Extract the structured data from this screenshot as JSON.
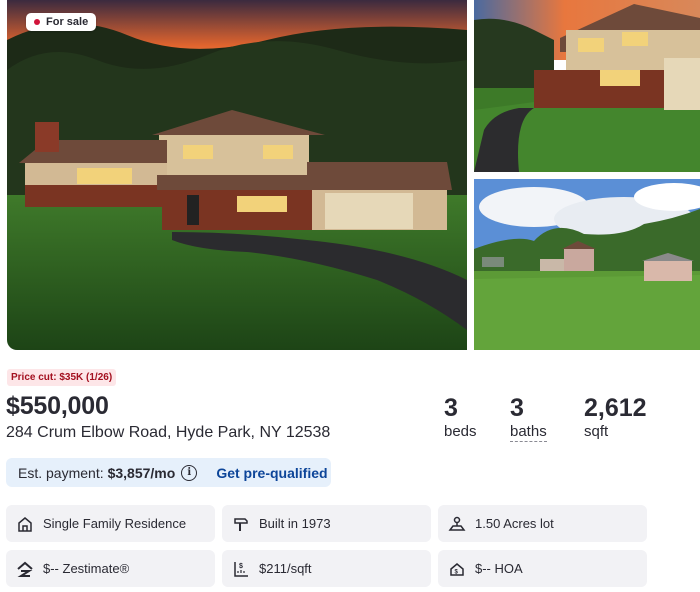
{
  "listing": {
    "status_badge": "For sale",
    "price_cut": "Price cut: $35K (1/26)",
    "price": "$550,000",
    "address": "284 Crum Elbow Road, Hyde Park, NY 12538"
  },
  "stats": {
    "beds": {
      "value": "3",
      "label": "beds"
    },
    "baths": {
      "value": "3",
      "label": "baths"
    },
    "sqft": {
      "value": "2,612",
      "label": "sqft"
    }
  },
  "payment": {
    "label": "Est. payment:",
    "value": "$3,857/mo",
    "info_icon": "i",
    "cta": "Get pre-qualified"
  },
  "facts": {
    "type": {
      "icon": "house-icon",
      "text": "Single Family Residence"
    },
    "built": {
      "icon": "hammer-icon",
      "text": "Built in 1973"
    },
    "lot": {
      "icon": "lot-icon",
      "text": "1.50 Acres lot"
    },
    "zestimate": {
      "icon": "zestimate-icon",
      "text": "$-- Zestimate®"
    },
    "price_per_sqft": {
      "icon": "ruler-icon",
      "text": "$211/sqft"
    },
    "hoa": {
      "icon": "hoa-icon",
      "text": "$-- HOA"
    }
  },
  "colors": {
    "sale_dot": "#d2143a",
    "price_cut_bg": "#fde6e8",
    "price_cut_text": "#a3101f",
    "payment_bg": "#e6f0fb",
    "cta_text": "#0d4599",
    "fact_bg": "#f2f2f5"
  }
}
